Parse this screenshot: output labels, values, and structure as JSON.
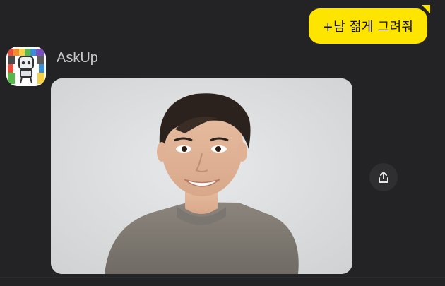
{
  "chat": {
    "outgoing_message": "+남 젊게 그려줘",
    "sender_name": "AskUp"
  },
  "icons": {
    "avatar": "robot-avatar-icon",
    "share": "share-icon"
  },
  "colors": {
    "background": "#232325",
    "bubble": "#fee500",
    "name": "#c9c9cc"
  }
}
